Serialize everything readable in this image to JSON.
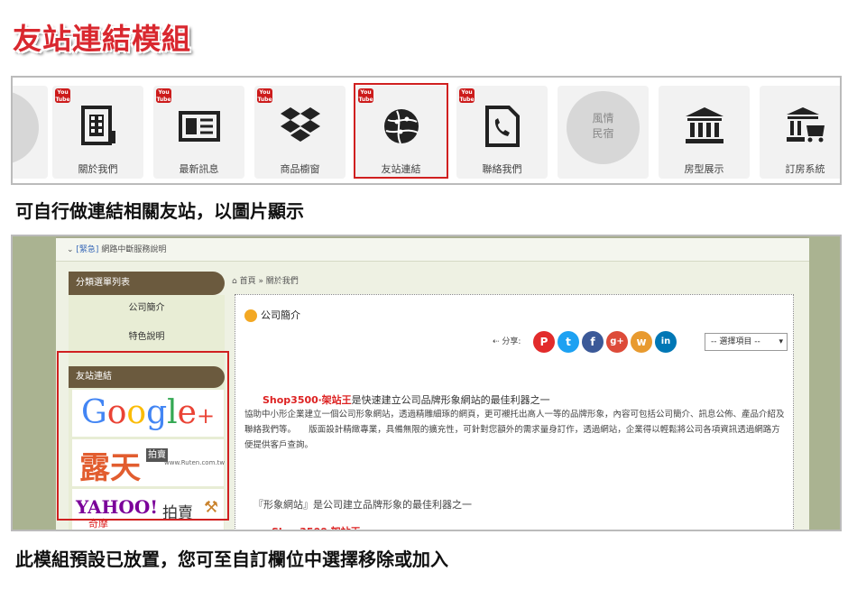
{
  "title": "友站連結模組",
  "tiles": [
    {
      "label": "關於我們",
      "icon": "building-document-icon"
    },
    {
      "label": "最新訊息",
      "icon": "newspaper-icon"
    },
    {
      "label": "商品櫥窗",
      "icon": "dropbox-icon"
    },
    {
      "label": "友站連結",
      "icon": "globe-icon"
    },
    {
      "label": "聯絡我們",
      "icon": "phone-document-icon"
    },
    {
      "label": "風情民宿",
      "circle_text": "風情\n民宿"
    },
    {
      "label": "房型展示",
      "icon": "bank-icon"
    },
    {
      "label": "訂房系統",
      "icon": "bank-cart-icon"
    }
  ],
  "youtube_badge": "You Tube",
  "caption1": "可自行做連結相關友站，以圖片顯示",
  "caption2": "此模組預設已放置，您可至自訂欄位中選擇移除或加入",
  "shot": {
    "topbar": {
      "tag": "[緊急]",
      "text": "網路中斷服務說明"
    },
    "sidebar_header": "分類選單列表",
    "sidebar_items": [
      "公司簡介",
      "特色說明"
    ],
    "friend_header": "友站連結",
    "google_logo": "Google+",
    "ruten_logo": "露天",
    "ruten_sub": "www.Ruten.com.tw",
    "ruten_badge": "拍賣",
    "yahoo_logo": "YAHOO!",
    "yahoo_sub": "奇摩",
    "yahoo_text": "拍賣",
    "breadcrumb": "首頁 » 關於我們",
    "content_title": "公司簡介",
    "share_label": "分享:",
    "share_icons": [
      "P",
      "t",
      "f",
      "g+",
      "w",
      "in"
    ],
    "select_value": "-- 選擇項目 --",
    "p1_red": "Shop3500‧架站王",
    "p1_text": "是快速建立公司品牌形象網站的最佳利器之一",
    "para": "協助中小形企業建立一個公司形象網站，透過精雕細琢的網頁，更可襯托出高人一等的品牌形象，內容可包括公司簡介、訊息公佈、產品介紹及聯絡我們等。　　版面設計精緻專業，具備無限的擴充性，可針對您額外的需求量身訂作，透過網站，企業得以輕鬆將公司各項資訊透過網路方便提供客戶查詢。",
    "p2": "『形象網站』是公司建立品牌形象的最佳利器之一",
    "p3": "Shop3500‧架站王"
  },
  "colors": {
    "accent": "#d02020",
    "sidebar": "#6b5a3e"
  }
}
